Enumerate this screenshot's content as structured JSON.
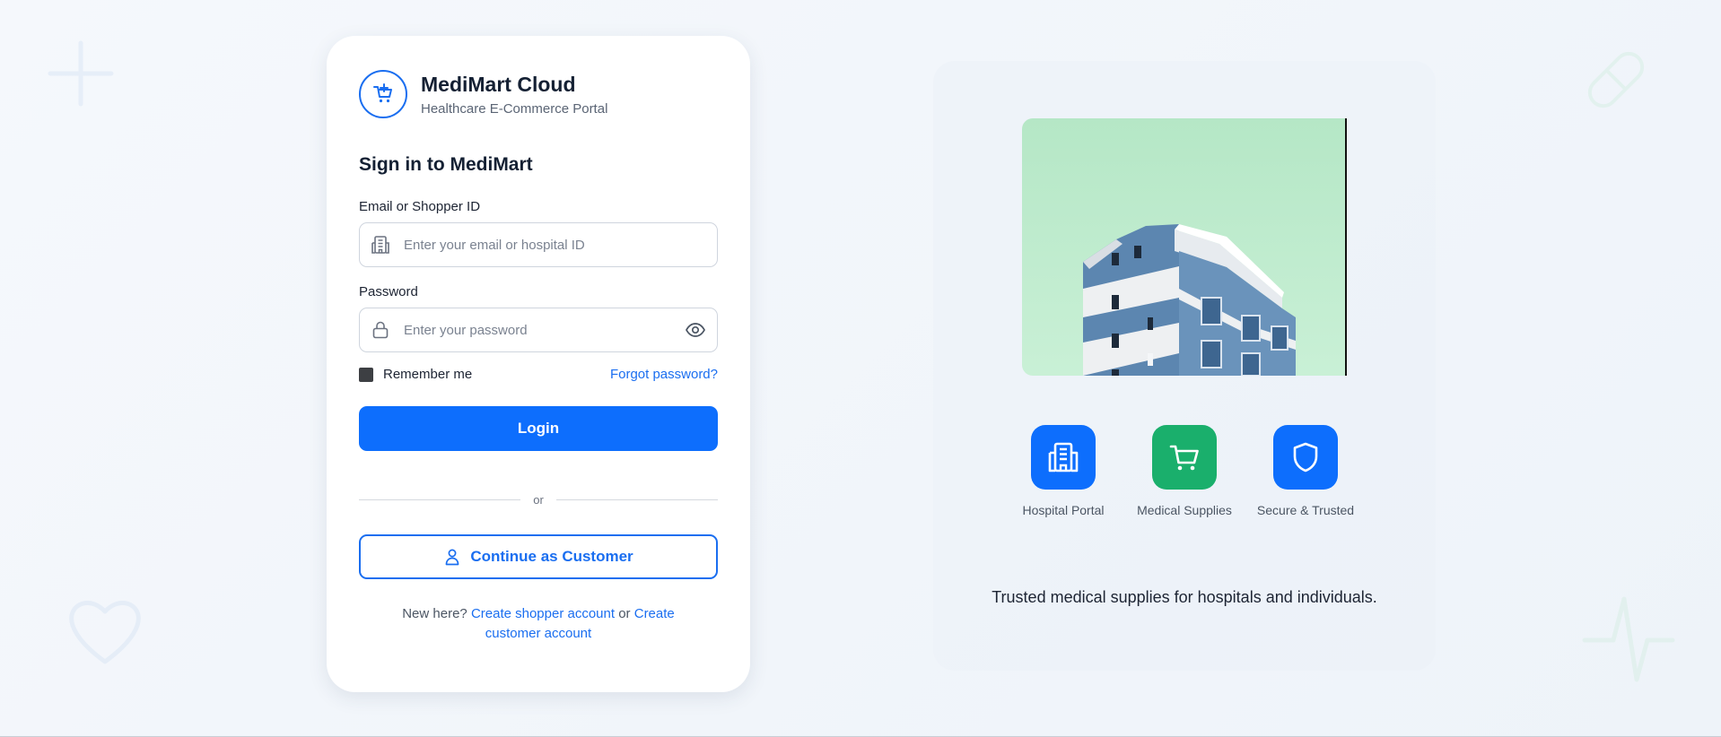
{
  "brand": {
    "name": "MediMart Cloud",
    "tagline": "Healthcare E-Commerce Portal"
  },
  "form": {
    "heading": "Sign in to MediMart",
    "email_label": "Email or Shopper ID",
    "email_placeholder": "Enter your email or hospital ID",
    "email_value": "",
    "password_label": "Password",
    "password_placeholder": "Enter your password",
    "password_value": "",
    "remember_label": "Remember me",
    "forgot_label": "Forgot password?",
    "login_label": "Login",
    "divider_label": "or",
    "customer_label": "Continue as Customer",
    "signup_prefix": "New here?",
    "signup_shopper_link": "Create shopper account",
    "signup_or": "or",
    "signup_customer_link": "Create customer account"
  },
  "features": [
    {
      "label": "Hospital Portal",
      "icon": "hospital-icon",
      "color": "#0d6efd"
    },
    {
      "label": "Medical Supplies",
      "icon": "cart-icon",
      "color": "#1aaf6c"
    },
    {
      "label": "Secure & Trusted",
      "icon": "shield-icon",
      "color": "#0d6efd"
    }
  ],
  "hero": {
    "image": "hospital-building-photo",
    "tagline": "Trusted medical supplies for hospitals and individuals."
  },
  "colors": {
    "primary": "#0d6efd",
    "accent_green": "#1aaf6c",
    "text_dark": "#142033"
  }
}
